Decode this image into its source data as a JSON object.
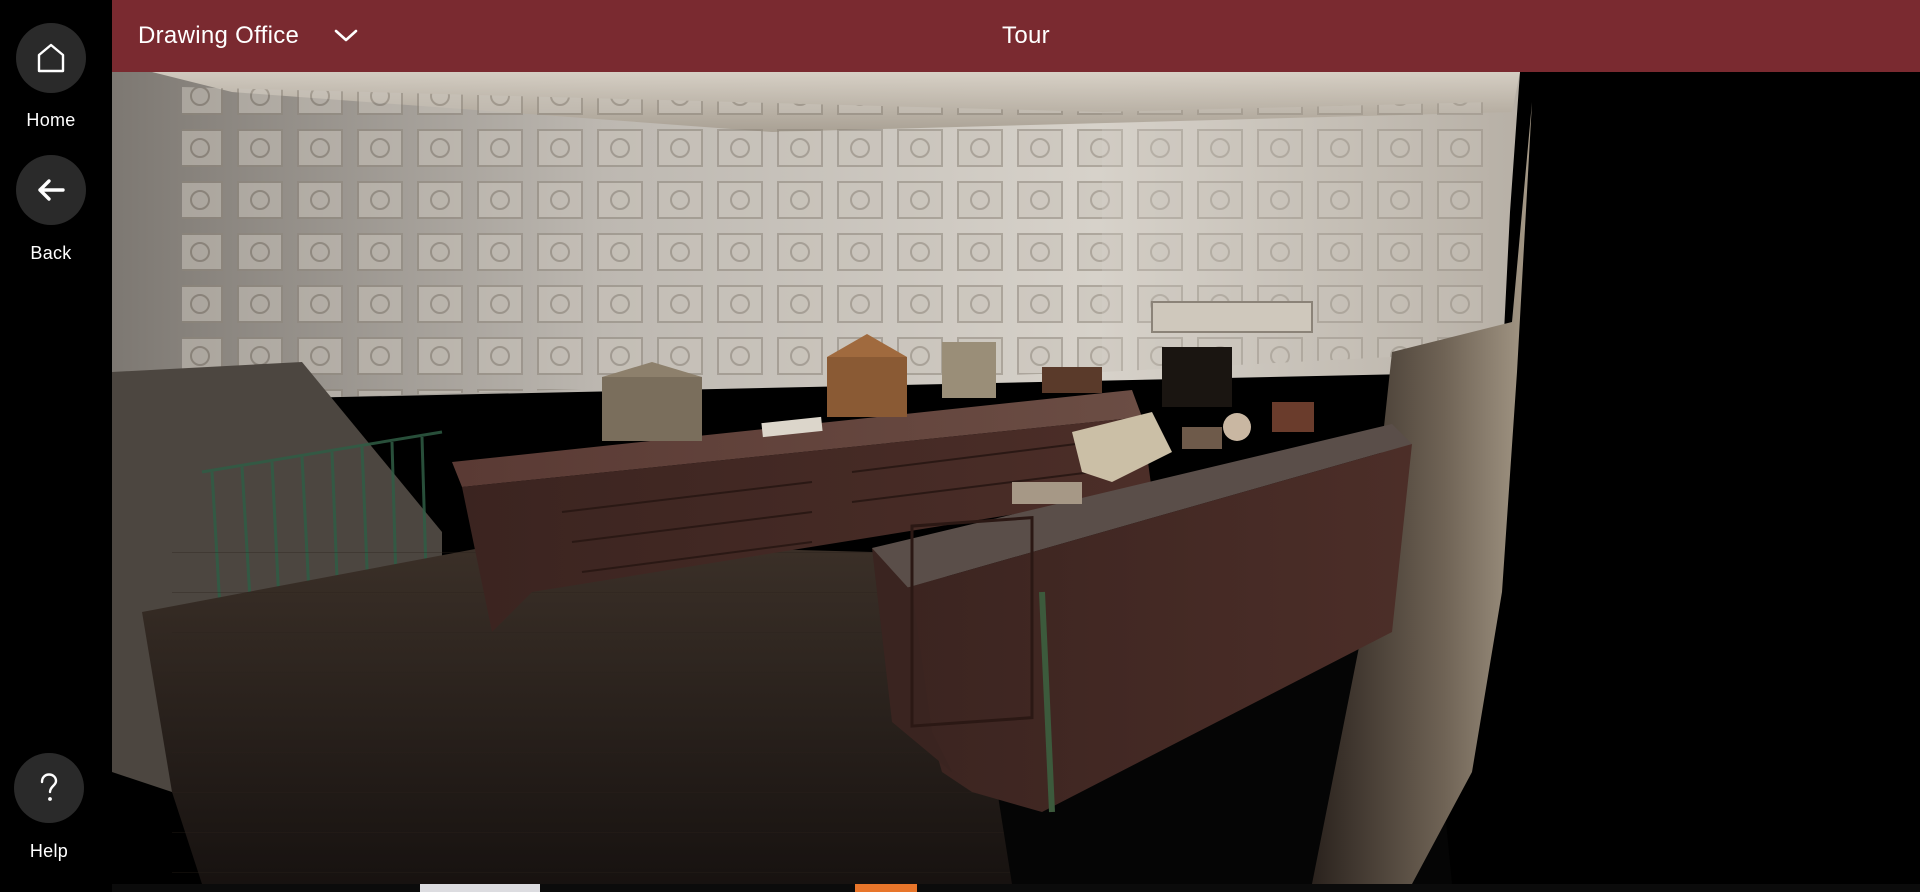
{
  "sidebar": {
    "home_label": "Home",
    "back_label": "Back",
    "help_label": "Help",
    "home_icon": "home-icon",
    "back_icon": "arrow-left-icon",
    "help_icon": "question-icon"
  },
  "header": {
    "location": "Drawing Office",
    "location_icon": "chevron-down-icon",
    "title": "Tour"
  },
  "colors": {
    "header_bg": "#7a2a30",
    "rail_button_bg": "#2a2a2a",
    "viewport_bg": "#000000"
  }
}
